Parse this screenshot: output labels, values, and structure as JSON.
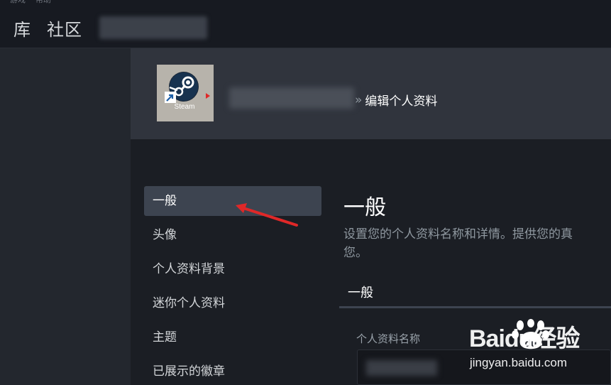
{
  "top_menu": [
    "游戏",
    "帮助"
  ],
  "nav": {
    "library": "库",
    "community": "社区"
  },
  "profile": {
    "avatar_label": "Steam",
    "breadcrumb_sep": "»",
    "breadcrumb_page": "编辑个人资料"
  },
  "sidebar": {
    "items": [
      {
        "label": "一般",
        "active": true
      },
      {
        "label": "头像",
        "active": false
      },
      {
        "label": "个人资料背景",
        "active": false
      },
      {
        "label": "迷你个人资料",
        "active": false
      },
      {
        "label": "主题",
        "active": false
      },
      {
        "label": "已展示的徽章",
        "active": false
      }
    ]
  },
  "main": {
    "title": "一般",
    "description_line1": "设置您的个人资料名称和详情。提供您的真",
    "description_line2": "您。",
    "section_title": "一般",
    "field_label": "个人资料名称"
  },
  "watermark": {
    "brand": "Baidu经验",
    "url": "jingyan.baidu.com"
  },
  "colors": {
    "background": "#1b1e24",
    "header": "#171a21",
    "profile_header": "#30343d",
    "active_item": "#3d4450",
    "steam_blue": "#1b5fa8",
    "annotation_red": "#e02828"
  }
}
